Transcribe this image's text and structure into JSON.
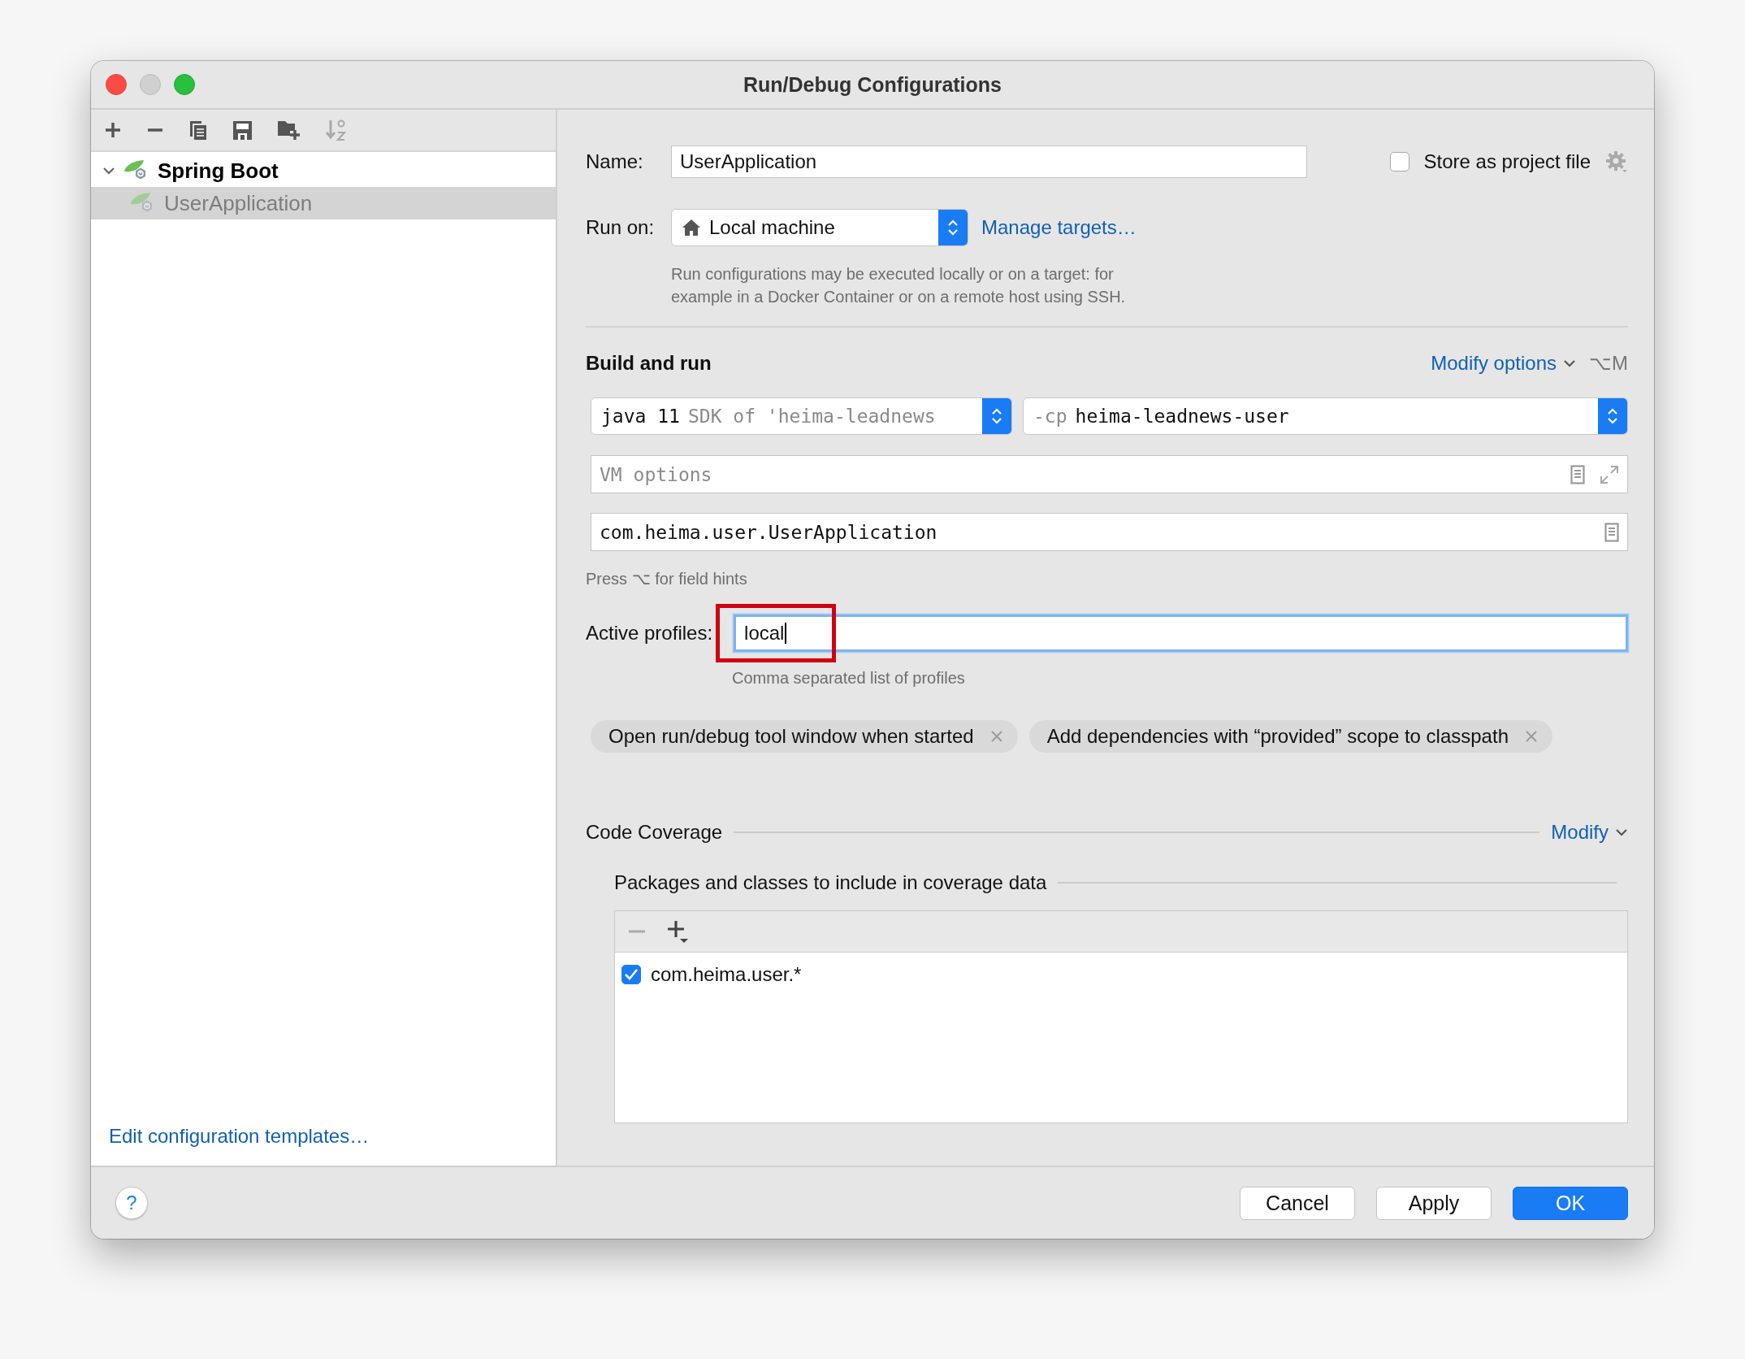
{
  "window": {
    "title": "Run/Debug Configurations"
  },
  "tree": [
    {
      "label": "Spring Boot",
      "expanded": true,
      "selected": false,
      "children": [
        {
          "label": "UserApplication",
          "selected": true
        }
      ]
    }
  ],
  "edit_templates_link": "Edit configuration templates…",
  "name_field": {
    "label": "Name:",
    "value": "UserApplication"
  },
  "store_as_project_file": {
    "label": "Store as project file",
    "checked": false
  },
  "run_on": {
    "label": "Run on:",
    "value": "Local machine",
    "link": "Manage targets…",
    "hint_lines": [
      "Run configurations may be executed locally or on a target: for",
      "example in a Docker Container or on a remote host using SSH."
    ]
  },
  "build_and_run": {
    "title": "Build and run",
    "modify_options": "Modify options",
    "shortcut": "⌥M",
    "jdk": {
      "value": "java 11",
      "detail": "SDK of 'heima-leadnews"
    },
    "classpath": {
      "prefix": "-cp",
      "value": "heima-leadnews-user"
    },
    "vm_options": {
      "placeholder": "VM options"
    },
    "main_class": {
      "value": "com.heima.user.UserApplication"
    },
    "field_hint": "Press ⌥ for field hints"
  },
  "active_profiles": {
    "label": "Active profiles:",
    "value": "local",
    "focused": true,
    "highlighted": true,
    "hint": "Comma separated list of profiles"
  },
  "option_tags": [
    {
      "label": "Open run/debug tool window when started"
    },
    {
      "label": "Add dependencies with “provided” scope to classpath"
    }
  ],
  "code_coverage": {
    "title": "Code Coverage",
    "modify": "Modify",
    "packages_title": "Packages and classes to include in coverage data",
    "entries": [
      {
        "label": "com.heima.user.*",
        "checked": true
      }
    ]
  },
  "help": "?",
  "buttons": [
    {
      "label": "Cancel",
      "kind": "secondary"
    },
    {
      "label": "Apply",
      "kind": "secondary"
    },
    {
      "label": "OK",
      "kind": "primary"
    }
  ]
}
